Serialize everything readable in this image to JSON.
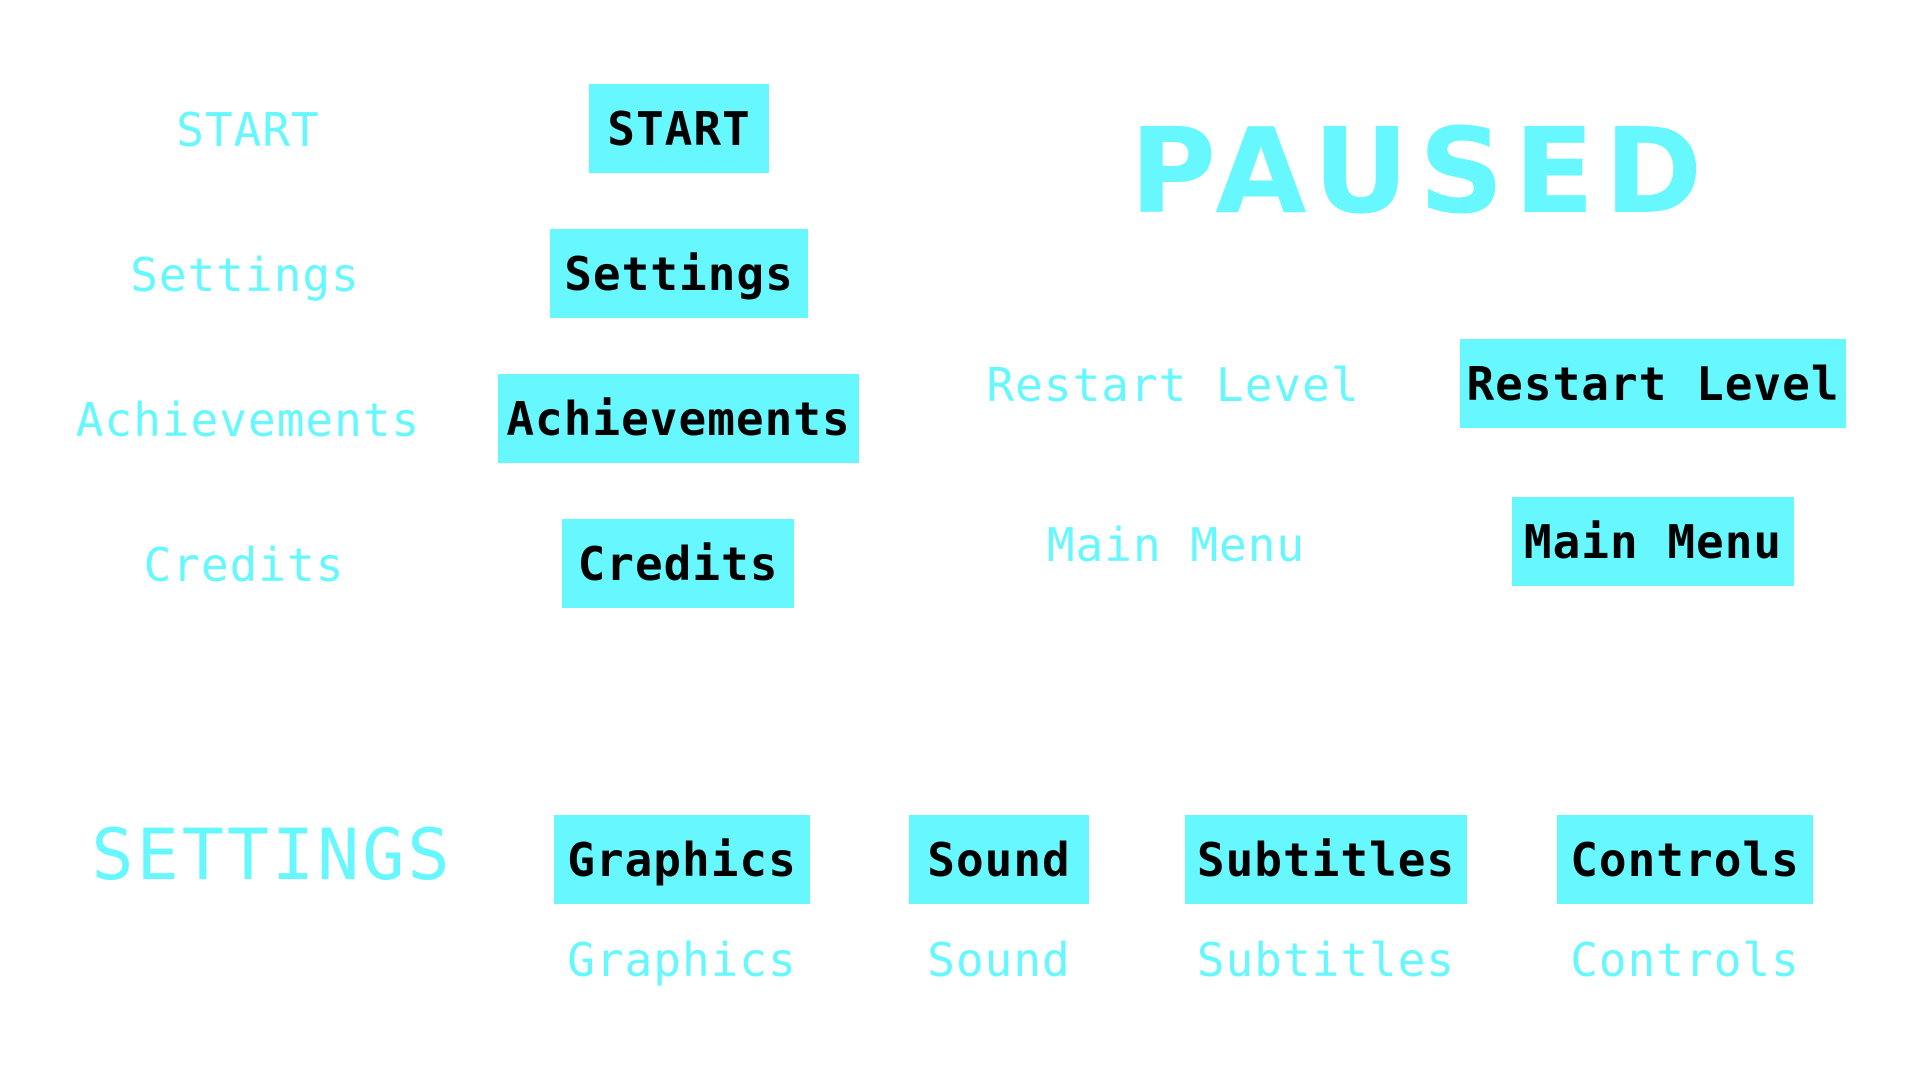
{
  "main_menu": {
    "labels": {
      "start": "START",
      "settings": "Settings",
      "achievements": "Achievements",
      "credits": "Credits"
    },
    "buttons": {
      "start": "START",
      "settings": "Settings",
      "achievements": "Achievements",
      "credits": "Credits"
    }
  },
  "pause_menu": {
    "title": "PAUSED",
    "labels": {
      "restart_level": "Restart Level",
      "main_menu": "Main Menu"
    },
    "buttons": {
      "restart_level": "Restart Level",
      "main_menu": "Main Menu"
    }
  },
  "settings_menu": {
    "title": "SETTINGS",
    "buttons": {
      "graphics": "Graphics",
      "sound": "Sound",
      "subtitles": "Subtitles",
      "controls": "Controls"
    },
    "labels": {
      "graphics": "Graphics",
      "sound": "Sound",
      "subtitles": "Subtitles",
      "controls": "Controls"
    }
  },
  "colors": {
    "accent": "#66f7ff",
    "button_text": "#000000",
    "background": "#ffffff"
  }
}
